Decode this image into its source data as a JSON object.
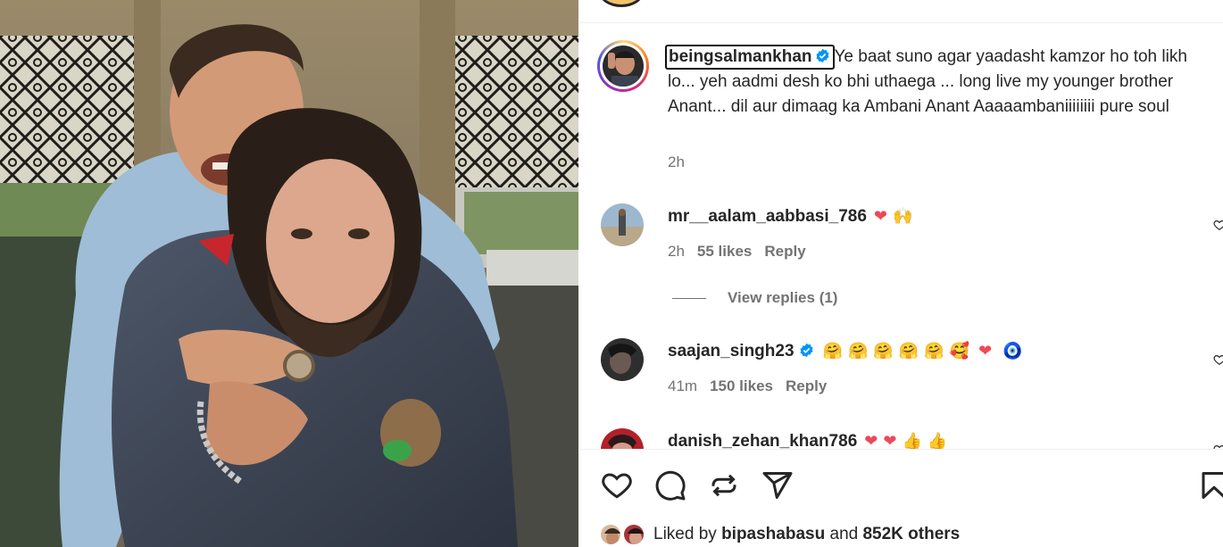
{
  "post": {
    "author": "beingsalmankhan",
    "caption": "Ye baat suno agar yaadasht kamzor ho toh likh lo... yeh aadmi desh ko bhi uthaega ... long live my younger brother Anant... dil aur dimaag ka Ambani Anant Aaaaambaniiiiiiii pure soul",
    "time": "2h"
  },
  "comments": [
    {
      "username": "mr__aalam_aabbasi_786",
      "verified": false,
      "emojis": [
        "heart-emoji",
        "raised-hands-emoji"
      ],
      "time": "2h",
      "likes": "55 likes",
      "reply_label": "Reply",
      "view_replies": "View replies (1)"
    },
    {
      "username": "saajan_singh23",
      "verified": true,
      "emojis": [
        "hugging-face-emoji",
        "hugging-face-emoji",
        "hugging-face-emoji",
        "hugging-face-emoji",
        "hugging-face-emoji",
        "smiling-face-with-hearts-emoji",
        "heart-emoji",
        "nazar-amulet-emoji"
      ],
      "time": "41m",
      "likes": "150 likes",
      "reply_label": "Reply"
    },
    {
      "username": "danish_zehan_khan786",
      "verified": false,
      "emojis": [
        "heart-emoji",
        "heart-emoji",
        "thumbs-up-emoji",
        "thumbs-up-emoji"
      ]
    }
  ],
  "actions": {
    "icons": [
      "heart-icon",
      "comment-icon",
      "repost-icon",
      "share-icon",
      "save-icon"
    ]
  },
  "likes_summary": {
    "prefix": "Liked by",
    "liker": "bipashabasu",
    "middle": "and",
    "count": "852K others"
  },
  "colors": {
    "text": "#262626",
    "muted": "#737373",
    "verified_blue": "#0095f6",
    "heart_red": "#ed4956",
    "border": "#efefef"
  }
}
